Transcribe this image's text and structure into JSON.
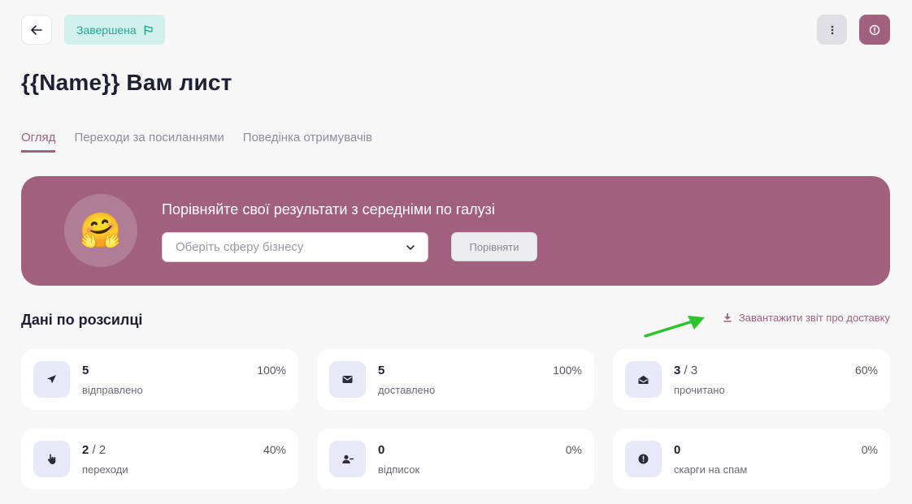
{
  "header": {
    "status_label": "Завершена",
    "icons": {
      "back": "arrow-left-icon",
      "status": "flag-icon",
      "more": "more-vertical-icon",
      "info": "info-icon"
    }
  },
  "page": {
    "title": "{{Name}} Вам лист"
  },
  "tabs": [
    {
      "label": "Огляд",
      "active": true
    },
    {
      "label": "Переходи за посиланнями",
      "active": false
    },
    {
      "label": "Поведінка отримувачів",
      "active": false
    }
  ],
  "banner": {
    "title": "Порівняйте свої результати з середніми по галузі",
    "select_placeholder": "Оберіть сферу бізнесу",
    "compare_label": "Порівняти",
    "emoji": "🤗",
    "color": "#a2607f"
  },
  "section": {
    "title": "Дані по розсилці",
    "download_label": "Завантажити звіт про доставку"
  },
  "stats": [
    {
      "value": "5",
      "total": "",
      "label": "відправлено",
      "percent": "100%",
      "icon": "send-icon"
    },
    {
      "value": "5",
      "total": "",
      "label": "доставлено",
      "percent": "100%",
      "icon": "mail-icon"
    },
    {
      "value": "3",
      "total": "3",
      "label": "прочитано",
      "percent": "60%",
      "icon": "mail-open-icon"
    },
    {
      "value": "2",
      "total": "2",
      "label": "переходи",
      "percent": "40%",
      "icon": "pointer-icon"
    },
    {
      "value": "0",
      "total": "",
      "label": "відписок",
      "percent": "0%",
      "icon": "user-minus-icon"
    },
    {
      "value": "0",
      "total": "",
      "label": "скарги на спам",
      "percent": "0%",
      "icon": "alert-icon"
    }
  ],
  "colors": {
    "accent": "#a2607f",
    "success": "#1fa98e",
    "annotation_arrow": "#2bc42b"
  }
}
